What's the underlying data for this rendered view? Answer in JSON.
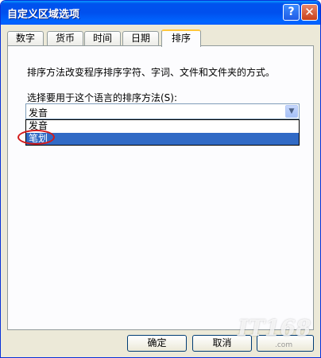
{
  "window": {
    "title": "自定义区域选项",
    "help_glyph": "?",
    "close_glyph": "✕"
  },
  "tabs": [
    {
      "label": "数字"
    },
    {
      "label": "货币"
    },
    {
      "label": "时间"
    },
    {
      "label": "日期"
    },
    {
      "label": "排序",
      "active": true
    }
  ],
  "sort_panel": {
    "description": "排序方法改变程序排序字符、字词、文件和文件夹的方式。",
    "select_label": "选择要用于这个语言的排序方法(S):",
    "selected_value": "发音",
    "options": [
      "发音",
      "笔划"
    ],
    "highlighted_option": "笔划"
  },
  "buttons": {
    "ok": "确定",
    "cancel": "取消",
    "apply": ""
  },
  "watermark": {
    "text": "IT168",
    "sub": ".com"
  },
  "icons": {
    "dropdown_arrow": "chevron-down-icon"
  },
  "colors": {
    "titlebar": "#0053ee",
    "selection": "#316ac5",
    "annotation_circle": "#d21a1a",
    "active_tab_accent": "#ffc73c"
  }
}
